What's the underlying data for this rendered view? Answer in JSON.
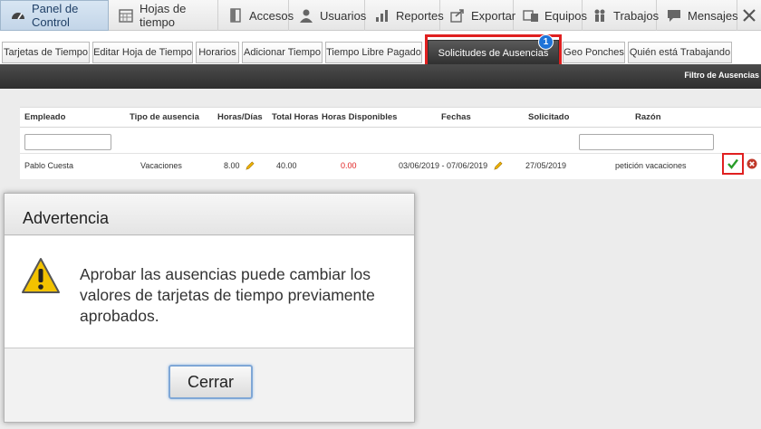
{
  "nav": {
    "items": [
      {
        "label": "Panel de Control",
        "icon": "dashboard-icon"
      },
      {
        "label": "Hojas de tiempo",
        "icon": "calendar-icon"
      },
      {
        "label": "Accesos",
        "icon": "door-icon"
      },
      {
        "label": "Usuarios",
        "icon": "user-icon"
      },
      {
        "label": "Reportes",
        "icon": "bar-chart-icon"
      },
      {
        "label": "Exportar",
        "icon": "export-icon"
      },
      {
        "label": "Equipos",
        "icon": "devices-icon"
      },
      {
        "label": "Trabajos",
        "icon": "workers-icon"
      },
      {
        "label": "Mensajes",
        "icon": "chat-icon"
      }
    ]
  },
  "tabs": [
    "Tarjetas de Tiempo",
    "Editar Hoja de Tiempo",
    "Horarios",
    "Adicionar Tiempo",
    "Tiempo Libre Pagado",
    "Solicitudes de Ausencias",
    "Geo Ponches",
    "Quién está Trabajando"
  ],
  "active_tab_badge": "1",
  "filter_label": "Filtro de Ausencias",
  "table": {
    "headers": [
      "Empleado",
      "Tipo de ausencia",
      "Horas/Días",
      "Total Horas",
      "Horas Disponibles",
      "Fechas",
      "Solicitado",
      "Razón"
    ],
    "row": {
      "employee": "Pablo Cuesta",
      "type": "Vacaciones",
      "hours_days": "8.00",
      "total_hours": "40.00",
      "available": "0.00",
      "dates": "03/06/2019 - 07/06/2019",
      "requested": "27/05/2019",
      "reason": "petición vacaciones"
    }
  },
  "dialog": {
    "title": "Advertencia",
    "message": "Aprobar las ausencias puede cambiar los valores de tarjetas de tiempo previamente aprobados.",
    "button": "Cerrar"
  },
  "colors": {
    "highlight": "#e02020",
    "badge": "#1e73d8",
    "approve": "#2a9d2a",
    "reject": "#c0392b",
    "warning": "#f2c200"
  }
}
